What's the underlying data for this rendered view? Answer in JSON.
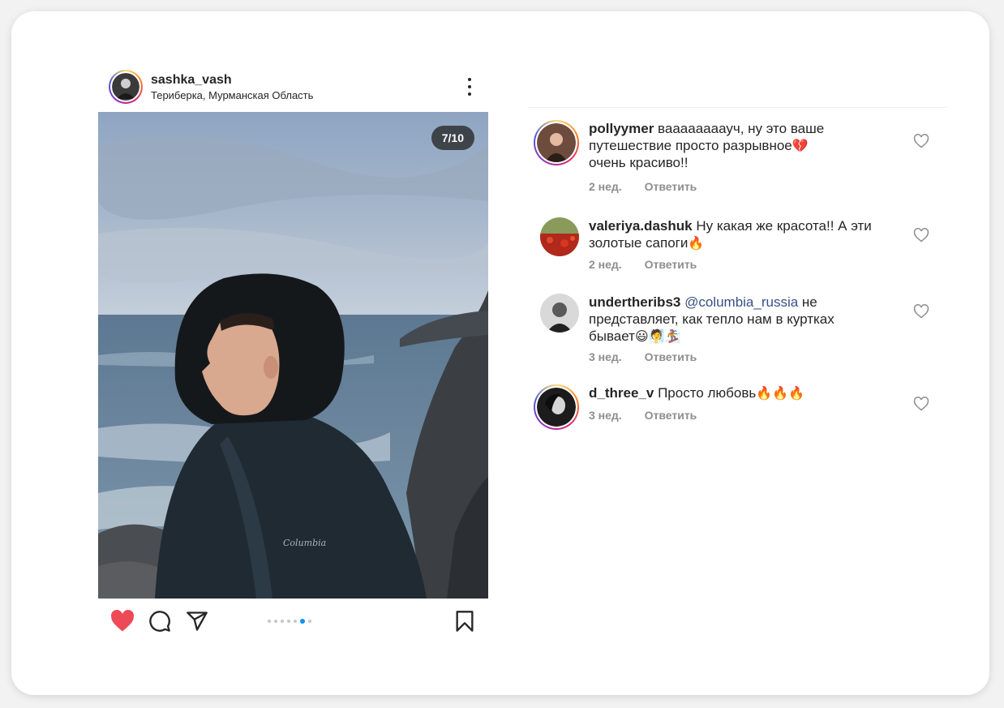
{
  "post": {
    "username": "sashka_vash",
    "location": "Териберка, Мурманская Область",
    "photo_counter": "7/10",
    "carousel_total": 7,
    "carousel_active": 5,
    "liked": true
  },
  "comments": [
    {
      "username": "pollyymer",
      "text_line1": "ваааааааауч, ну это ваше",
      "text_line2": "путешествие просто разрывное",
      "emoji2": "💔",
      "text_line3": "очень красиво!!",
      "time": "2 нед.",
      "reply": "Ответить"
    },
    {
      "username": "valeriya.dashuk",
      "text_line1": "Ну какая же красота!! А эти",
      "text_line2": "золотые сапоги",
      "emoji2": "🔥",
      "time": "2 нед.",
      "reply": "Ответить"
    },
    {
      "username": "undertheribs3",
      "mention": "@columbia_russia",
      "text_line1": "не",
      "text_line2": "представляет, как тепло нам в куртках",
      "text_line3": "бывает",
      "emoji3": "😃🧖🏂",
      "time": "3 нед.",
      "reply": "Ответить"
    },
    {
      "username": "d_three_v",
      "text_line1": "Просто любовь",
      "emoji1": "🔥🔥🔥",
      "time": "3 нед.",
      "reply": "Ответить"
    }
  ],
  "colors": {
    "like_red": "#ed4956",
    "active_dot": "#0095f6",
    "mention": "#385185"
  }
}
